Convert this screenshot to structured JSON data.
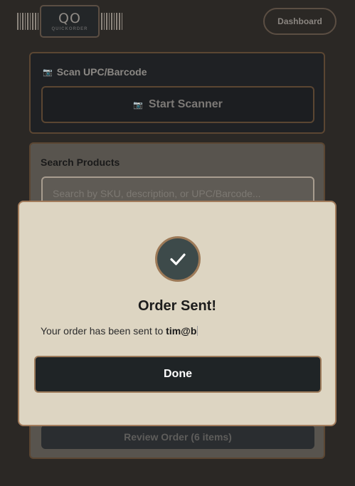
{
  "header": {
    "logo_mark": "QO",
    "logo_sub": "QUICKORDER",
    "dashboard_label": "Dashboard"
  },
  "scan": {
    "title": "Scan UPC/Barcode",
    "camera_icon": "camera-icon",
    "start_label": "Start Scanner"
  },
  "search": {
    "title": "Search Products",
    "placeholder": "Search by SKU, description, or UPC/Barcode..."
  },
  "review": {
    "label": "Review Order (6 items)"
  },
  "modal": {
    "icon": "checkmark-icon",
    "title": "Order Sent!",
    "message_prefix": "Your order has been sent to ",
    "email": "tim@b",
    "done_label": "Done"
  },
  "colors": {
    "background": "#2b2825",
    "panel": "#1f2124",
    "accent_border": "#5b4632",
    "modal_bg": "#ddd5c2",
    "modal_border": "#a27c5c",
    "check_bg": "#3d4a4a",
    "done_bg": "#1f2426"
  }
}
